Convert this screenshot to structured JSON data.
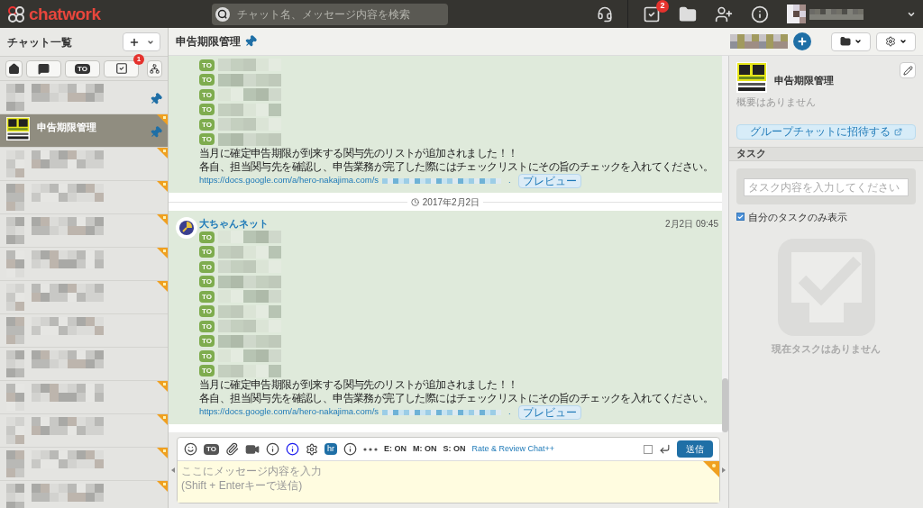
{
  "topbar": {
    "logo": "chatwork",
    "search": {
      "placeholder": "チャット名、メッセージ内容を検索"
    },
    "task_badge": "2"
  },
  "sidebar": {
    "title": "チャット一覧",
    "filters": [
      {
        "kind": "home",
        "selected": false
      },
      {
        "kind": "mention",
        "selected": false
      },
      {
        "kind": "to",
        "label": "TO",
        "selected": false
      },
      {
        "kind": "task",
        "badge": "1",
        "selected": false
      }
    ],
    "rooms": [
      {
        "selected": false,
        "pinned": true,
        "unread_marker": false
      },
      {
        "name": "申告期限管理",
        "selected": true,
        "pinned": true,
        "unread_marker": true
      },
      {
        "selected": false,
        "pinned": false,
        "unread_marker": true
      },
      {
        "selected": false,
        "pinned": false,
        "unread_marker": true
      },
      {
        "selected": false,
        "pinned": false,
        "unread_marker": true
      },
      {
        "selected": false,
        "pinned": false,
        "unread_marker": true
      },
      {
        "selected": false,
        "pinned": false,
        "unread_marker": true
      },
      {
        "selected": false,
        "pinned": false,
        "unread_marker": false
      },
      {
        "selected": false,
        "pinned": false,
        "unread_marker": false
      },
      {
        "selected": false,
        "pinned": false,
        "unread_marker": true
      },
      {
        "selected": false,
        "pinned": false,
        "unread_marker": true
      },
      {
        "selected": false,
        "pinned": false,
        "unread_marker": true
      },
      {
        "selected": false,
        "pinned": false,
        "unread_marker": true
      }
    ]
  },
  "chat": {
    "title": "申告期限管理",
    "pinned": true,
    "messages": [
      {
        "kind": "continued",
        "to": [
          "TO",
          "TO",
          "TO",
          "TO",
          "TO",
          "TO"
        ],
        "body": [
          "当月に確定申告期限が到来する関与先のリストが追加されました！！",
          "各自、担当関与先を確認し、申告業務が完了した際にはチェックリストにその旨のチェックを入れてください。"
        ],
        "link": "https://docs.google.com/a/hero-nakajima.com/s",
        "link_end": ".",
        "preview": "プレビュー"
      },
      {
        "kind": "date",
        "date": "2017年2月2日"
      },
      {
        "kind": "full",
        "author": "大ちゃんネット",
        "time": "2月2日 09:45",
        "to": [
          "TO",
          "TO",
          "TO",
          "TO",
          "TO",
          "TO",
          "TO",
          "TO",
          "TO",
          "TO"
        ],
        "body": [
          "当月に確定申告期限が到来する関与先のリストが追加されました！！",
          "各自、担当関与先を確認し、申告業務が完了した際にはチェックリストにその旨のチェックを入れてください。"
        ],
        "link": "https://docs.google.com/a/hero-nakajima.com/s",
        "link_end": ".",
        "preview": "プレビュー"
      }
    ],
    "composer": {
      "to_label": "TO",
      "hr_label": "hr",
      "toggles": [
        "E: ON",
        "M: ON",
        "S: ON"
      ],
      "plugin_link": "Rate & Review Chat++",
      "enter_to_send": false,
      "send": "送信",
      "placeholder": [
        "ここにメッセージ内容を入力",
        "(Shift + Enterキーで送信)"
      ]
    }
  },
  "room_panel": {
    "name": "申告期限管理",
    "description": "概要はありません",
    "invite": "グループチャットに招待する",
    "tasks": {
      "title": "タスク",
      "placeholder": "タスク内容を入力してください",
      "only_mine": {
        "label": "自分のタスクのみ表示",
        "checked": true
      },
      "empty": "現在タスクはありません"
    }
  }
}
